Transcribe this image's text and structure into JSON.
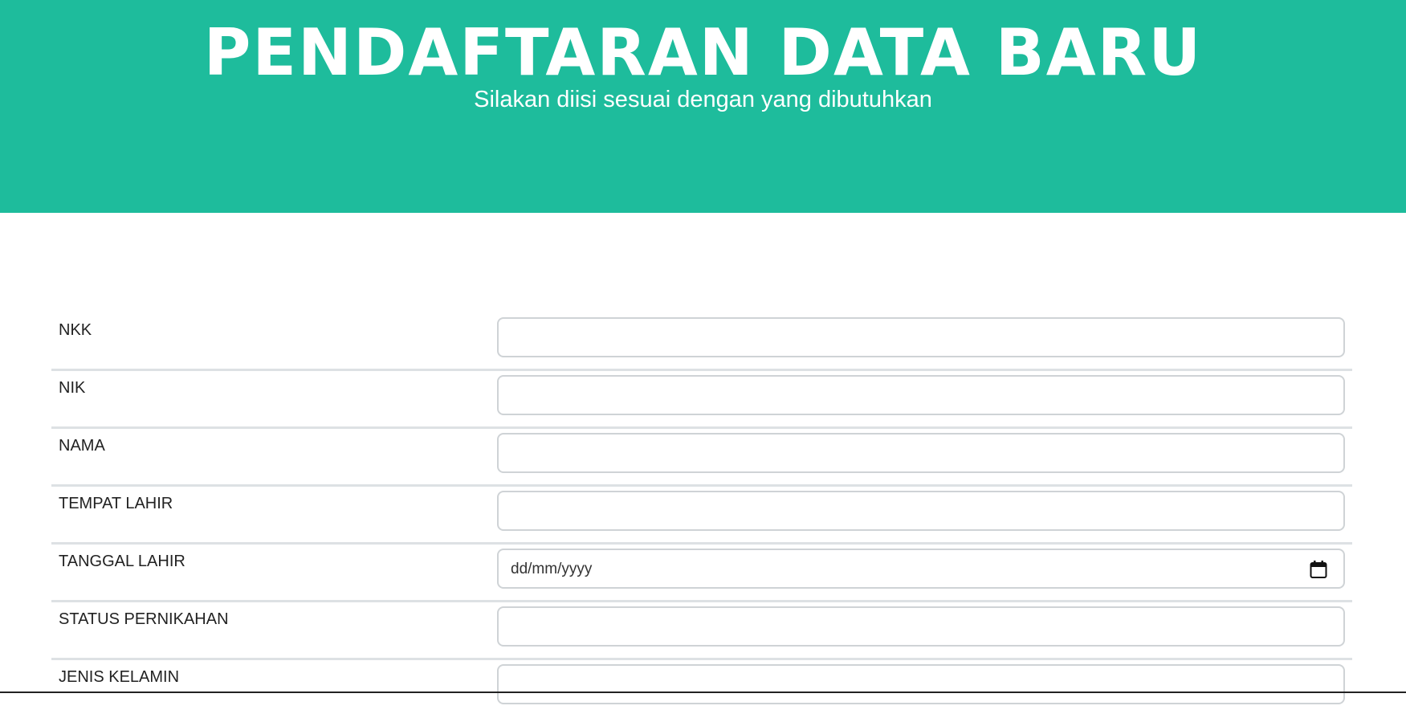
{
  "header": {
    "title": "PENDAFTARAN DATA BARU",
    "subtitle": "Silakan diisi sesuai dengan yang dibutuhkan"
  },
  "form": {
    "fields": [
      {
        "label": "NKK",
        "value": ""
      },
      {
        "label": "NIK",
        "value": ""
      },
      {
        "label": "NAMA",
        "value": ""
      },
      {
        "label": "TEMPAT LAHIR",
        "value": ""
      },
      {
        "label": "TANGGAL LAHIR",
        "placeholder": "dd/mm/yyyy",
        "icon": "calendar-icon"
      },
      {
        "label": "STATUS PERNIKAHAN",
        "value": ""
      },
      {
        "label": "JENIS KELAMIN",
        "value": ""
      }
    ]
  },
  "colors": {
    "header_bg": "#1ebc9c",
    "header_text": "#ffffff"
  }
}
